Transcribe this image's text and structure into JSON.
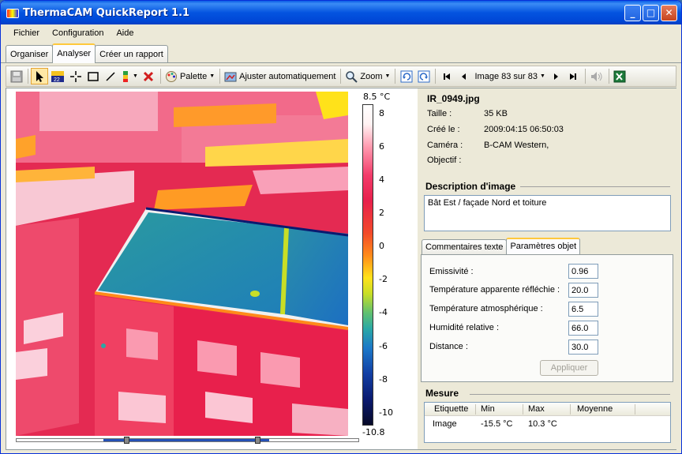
{
  "window": {
    "title": "ThermaCAM QuickReport 1.1"
  },
  "menu": [
    "Fichier",
    "Configuration",
    "Aide"
  ],
  "tabs": [
    "Organiser",
    "Analyser",
    "Créer un rapport"
  ],
  "toolbar": {
    "palette_label": "Palette",
    "auto_adjust_label": "Ajuster automatiquement",
    "zoom_label": "Zoom",
    "image_nav_label": "Image 83 sur 83"
  },
  "scale": {
    "max": "8.5 °C",
    "min": "-10.8",
    "ticks": [
      "8",
      "6",
      "4",
      "2",
      "0",
      "-2",
      "-4",
      "-6",
      "-8",
      "-10"
    ]
  },
  "file": {
    "name": "IR_0949.jpg",
    "size_label": "Taille :",
    "size_value": "35 KB",
    "created_label": "Créé le :",
    "created_value": "2009:04:15 06:50:03",
    "camera_label": "Caméra :",
    "camera_value": "B-CAM Western,",
    "lens_label": "Objectif :"
  },
  "description": {
    "title": "Description d'image",
    "text": "Bât Est  / façade Nord et toiture"
  },
  "subtabs": [
    "Commentaires texte",
    "Paramètres objet"
  ],
  "params": [
    {
      "label": "Emissivité :",
      "value": "0.96"
    },
    {
      "label": "Température apparente réfléchie :",
      "value": "20.0"
    },
    {
      "label": "Température atmosphérique :",
      "value": "6.5"
    },
    {
      "label": "Humidité relative :",
      "value": "66.0"
    },
    {
      "label": "Distance :",
      "value": "30.0"
    }
  ],
  "apply_label": "Appliquer",
  "measure": {
    "title": "Mesure",
    "headers": [
      "Etiquette",
      "Min",
      "Max",
      "Moyenne"
    ],
    "row": [
      "Image",
      "-15.5 °C",
      "10.3 °C",
      ""
    ]
  }
}
